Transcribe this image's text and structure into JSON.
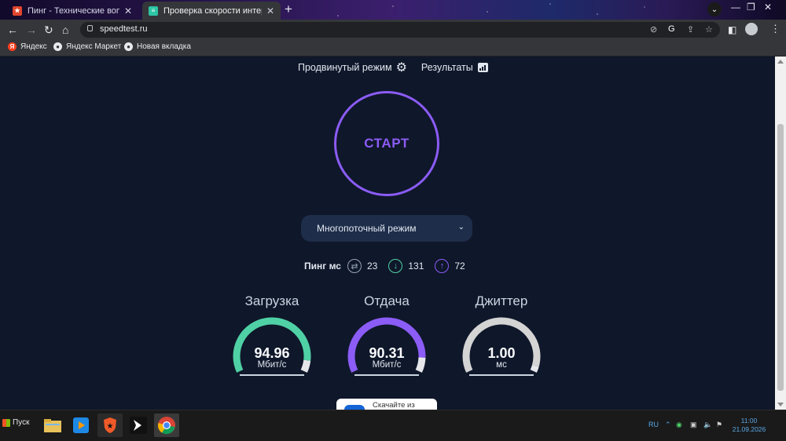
{
  "browser": {
    "tabs": [
      {
        "title": "Пинг - Технические вопросы - (",
        "state": "inactive"
      },
      {
        "title": "Проверка скорости интернета",
        "state": "active"
      }
    ],
    "new_tab": "+",
    "window_controls": [
      "—",
      "❐",
      "✕"
    ],
    "url": "speedtest.ru",
    "bookmarks": [
      "Яндекс",
      "Яндекс Маркет",
      "Новая вкладка"
    ]
  },
  "page": {
    "nav": {
      "advanced_mode": "Продвинутый режим",
      "results": "Результаты"
    },
    "start_label": "СТАРТ",
    "mode_select": "Многопоточный режим",
    "ping": {
      "label": "Пинг мс",
      "ping": "23",
      "download": "131",
      "upload": "72"
    },
    "metrics": [
      {
        "title": "Загрузка",
        "value": "94.96",
        "unit": "Мбит/с",
        "color": "#4fd1a5",
        "fraction": 0.92
      },
      {
        "title": "Отдача",
        "value": "90.31",
        "unit": "Мбит/с",
        "color": "#8b5cf6",
        "fraction": 0.9
      },
      {
        "title": "Джиттер",
        "value": "1.00",
        "unit": "мс",
        "color": "#d4d4d4",
        "fraction": 0.96
      }
    ],
    "app_card_text": "Скачайте из"
  },
  "taskbar": {
    "start": "Пуск",
    "language": "RU",
    "time": "11:00",
    "date": "21.09.2026"
  },
  "colors": {
    "accent": "#8b5cf6",
    "download": "#4fd1a5",
    "page_bg": "#0f172a"
  }
}
